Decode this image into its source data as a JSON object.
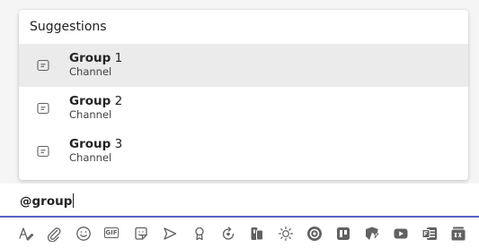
{
  "suggestions": {
    "header": "Suggestions",
    "items": [
      {
        "bold": "Group",
        "rest": " 1",
        "subtitle": "Channel",
        "selected": true,
        "icon": "channel-icon"
      },
      {
        "bold": "Group",
        "rest": " 2",
        "subtitle": "Channel",
        "selected": false,
        "icon": "channel-icon"
      },
      {
        "bold": "Group",
        "rest": " 3",
        "subtitle": "Channel",
        "selected": false,
        "icon": "channel-icon"
      }
    ]
  },
  "composer": {
    "value": "@group"
  },
  "toolbar": {
    "icons": [
      "format-icon",
      "attach-icon",
      "emoji-icon",
      "gif-icon",
      "sticker-icon",
      "meet-now-icon",
      "praise-icon",
      "loop-icon",
      "approvals-icon",
      "weather-icon",
      "app-circle-icon",
      "planner-icon",
      "power-automate-icon",
      "youtube-icon",
      "forms-icon",
      "stream-icon"
    ],
    "gif_label": "GIF"
  },
  "colors": {
    "accent": "#5b5fc7",
    "selected_bg": "#ebebeb",
    "icon": "#616161",
    "text": "#242424"
  }
}
